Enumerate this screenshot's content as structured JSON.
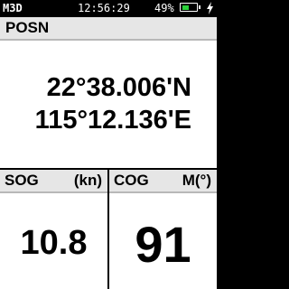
{
  "status": {
    "fix_mode": "M3D",
    "time": "12:56:29",
    "battery_percent_text": "49%",
    "battery_level": 0.49,
    "charging_icon": "lightning-icon",
    "battery_fill_color": "#2bd23a"
  },
  "posn": {
    "title": "POSN",
    "latitude": "22°38.006'N",
    "longitude": "115°12.136'E"
  },
  "sog": {
    "title": "SOG",
    "unit": "(kn)",
    "value": "10.8"
  },
  "cog": {
    "title": "COG",
    "unit": "M(°)",
    "value": "91"
  }
}
